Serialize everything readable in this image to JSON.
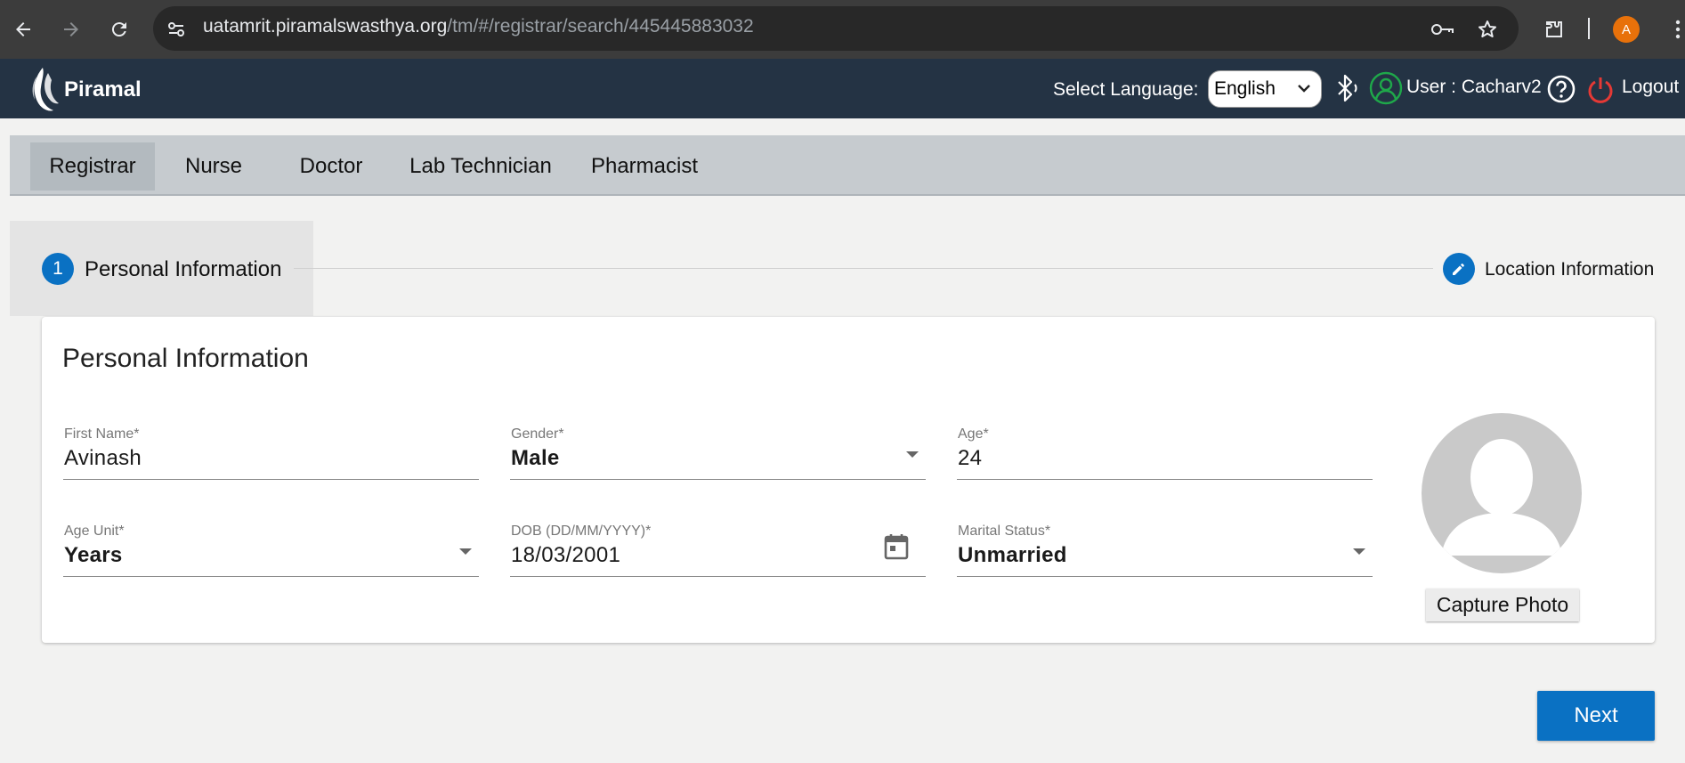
{
  "browser": {
    "url_host": "uatamrit.piramalswasthya.org",
    "url_path": "/tm/#/registrar/search/445445883032",
    "profile_initial": "A"
  },
  "header": {
    "logo_text": "Piramal",
    "language_label": "Select Language:",
    "language_selected": "English",
    "user_label": "User :",
    "user_name": "Cacharv2",
    "logout_label": "Logout"
  },
  "roles": [
    {
      "label": "Registrar",
      "active": true
    },
    {
      "label": "Nurse",
      "active": false
    },
    {
      "label": "Doctor",
      "active": false
    },
    {
      "label": "Lab Technician",
      "active": false
    },
    {
      "label": "Pharmacist",
      "active": false
    }
  ],
  "stepper": {
    "step1_number": "1",
    "step1_label": "Personal Information",
    "step2_label": "Location Information"
  },
  "form": {
    "title": "Personal Information",
    "first_name": {
      "label": "First Name",
      "required": "*",
      "value": "Avinash"
    },
    "gender": {
      "label": "Gender",
      "required": "*",
      "value": "Male"
    },
    "age": {
      "label": "Age",
      "required": "*",
      "value": "24"
    },
    "age_unit": {
      "label": "Age Unit",
      "required": "*",
      "value": "Years"
    },
    "dob": {
      "label": "DOB (DD/MM/YYYY)",
      "required": "*",
      "value": "18/03/2001"
    },
    "marital_status": {
      "label": "Marital Status",
      "required": "*",
      "value": "Unmarried"
    },
    "capture_photo_label": "Capture Photo",
    "next_label": "Next"
  },
  "colors": {
    "header_bg": "#243344",
    "primary": "#0a71c3",
    "role_bar": "#c6cbcf"
  }
}
